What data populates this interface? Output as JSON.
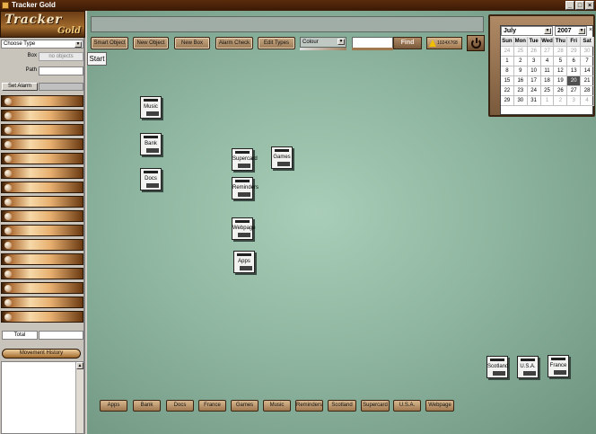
{
  "window": {
    "title": "Tracker Gold",
    "min": "_",
    "max": "□",
    "close": "×"
  },
  "logo": {
    "line1": "Tracker",
    "line2": "Gold"
  },
  "left": {
    "choose_type": "Choose Type",
    "box_label": "Box",
    "box_value": "no objects",
    "path_label": "Path",
    "set_alarm": "Set Alarm",
    "total_label": "Total",
    "movement_history": "Movement History",
    "scroll_up": "▲"
  },
  "toolbar": {
    "smart_object": "Smart Object",
    "new_object": "New Object",
    "new_box": "New Box",
    "alarm_check": "Alarm Check",
    "edit_types": "Edit Types",
    "colour": "Colour",
    "find": "Find",
    "alarm_count": "1024X768",
    "start": "Start",
    "dropdown_glyph": "▼"
  },
  "calendar": {
    "month": "July",
    "year": "2007",
    "close": "×",
    "days": [
      "Sun",
      "Mon",
      "Tue",
      "Wed",
      "Thu",
      "Fri",
      "Sat"
    ],
    "weeks": [
      [
        "24",
        "25",
        "26",
        "27",
        "28",
        "29",
        "30"
      ],
      [
        "1",
        "2",
        "3",
        "4",
        "5",
        "6",
        "7"
      ],
      [
        "8",
        "9",
        "10",
        "11",
        "12",
        "13",
        "14"
      ],
      [
        "15",
        "16",
        "17",
        "18",
        "19",
        "20",
        "21"
      ],
      [
        "22",
        "23",
        "24",
        "25",
        "26",
        "27",
        "28"
      ],
      [
        "29",
        "30",
        "31",
        "1",
        "2",
        "3",
        "4"
      ]
    ],
    "today": "20"
  },
  "objects": {
    "music": "Music",
    "bank": "Bank",
    "docs": "Docs",
    "supercard": "Supercard",
    "games": "Games",
    "reminders": "Reminders",
    "webpage": "Webpage",
    "apps": "Apps",
    "scotland": "Scotland",
    "usa": "U.S.A.",
    "france": "France"
  },
  "bottom": [
    "Apps",
    "Bank",
    "Docs",
    "France",
    "Games",
    "Music",
    "Reminders",
    "Scotland",
    "Supercard",
    "U.S.A.",
    "Webpage"
  ]
}
